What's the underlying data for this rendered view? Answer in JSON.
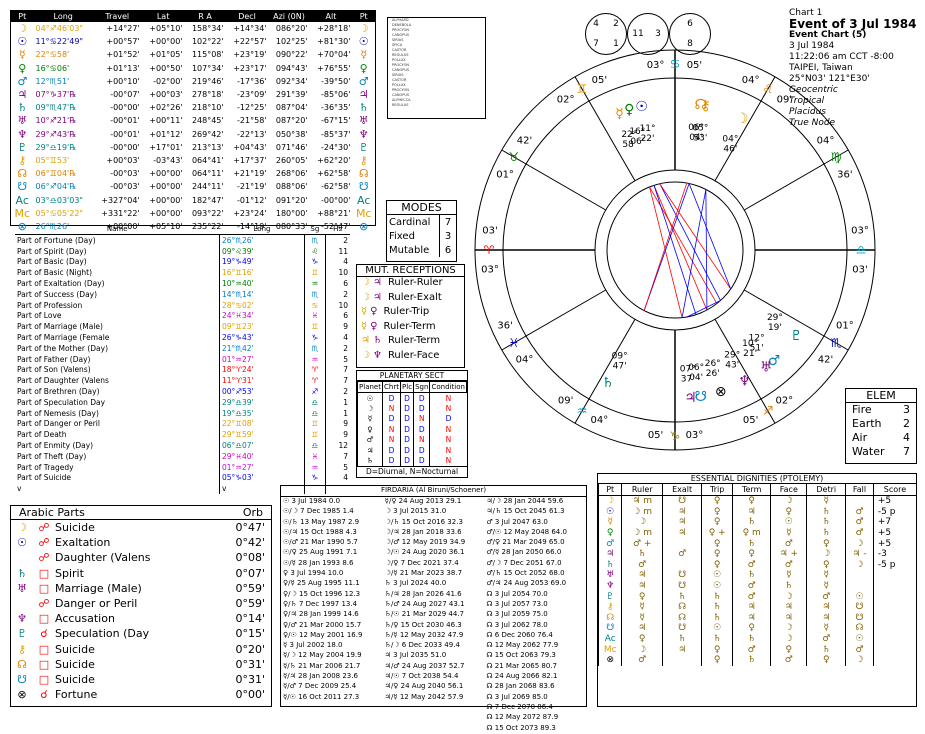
{
  "colors": {
    "blue": "#0000ff",
    "red": "#ff0000",
    "green": "#008000",
    "cyan": "#00a0c0",
    "orange": "#e08000",
    "purple": "#800080",
    "brown": "#804000",
    "olive": "#808000",
    "magenta": "#d000d0"
  },
  "positions": {
    "headers": [
      "Pt",
      "Long",
      "Travel",
      "Lat",
      "R A",
      "Decl",
      "Azi (0N)",
      "Alt",
      "Pt"
    ],
    "rows": [
      {
        "g": "☽",
        "long": "04°♐46'03\"",
        "travel": "+14°27'",
        "lat": "+05°10'",
        "ra": "158°34'",
        "decl": "+14°34'",
        "azi": "086°20'",
        "alt": "+28°18'",
        "c": "#e0a000"
      },
      {
        "g": "☉",
        "long": "11°♋22'49\"",
        "travel": "+00°57'",
        "lat": "+00°00'",
        "ra": "102°22'",
        "decl": "+22°57'",
        "azi": "102°25'",
        "alt": "+81°30'",
        "c": "#0000c0"
      },
      {
        "g": "☿",
        "long": "22°♋58'",
        "travel": "+01°52'",
        "lat": "+01°05'",
        "ra": "115°08'",
        "decl": "+23°19'",
        "azi": "090°22'",
        "alt": "+70°04'",
        "c": "#e08000"
      },
      {
        "g": "♀",
        "long": "16°♋06'",
        "travel": "+01°13'",
        "lat": "+00°50'",
        "ra": "107°34'",
        "decl": "+23°17'",
        "azi": "094°43'",
        "alt": "+76°55'",
        "c": "#008000"
      },
      {
        "g": "♂",
        "long": "12°♏51'",
        "travel": "+00°10'",
        "lat": "-02°00'",
        "ra": "219°46'",
        "decl": "-17°36'",
        "azi": "092°34'",
        "alt": "-39°50'",
        "c": "#0080c0"
      },
      {
        "g": "♃",
        "long": "07°♑37'℞",
        "travel": "-00°07'",
        "lat": "+00°03'",
        "ra": "278°18'",
        "decl": "-23°09'",
        "azi": "291°39'",
        "alt": "-85°06'",
        "c": "#800080"
      },
      {
        "g": "♄",
        "long": "09°♏47'℞",
        "travel": "-00°00'",
        "lat": "+02°26'",
        "ra": "218°10'",
        "decl": "-12°25'",
        "azi": "087°04'",
        "alt": "-36°35'",
        "c": "#008080"
      },
      {
        "g": "♅",
        "long": "10°♐21'℞",
        "travel": "-00°01'",
        "lat": "+00°11'",
        "ra": "248°45'",
        "decl": "-21°58'",
        "azi": "087°20'",
        "alt": "-67°15'",
        "c": "#800080"
      },
      {
        "g": "♆",
        "long": "29°♐43'℞",
        "travel": "-00°01'",
        "lat": "+01°12'",
        "ra": "269°42'",
        "decl": "-22°13'",
        "azi": "050°38'",
        "alt": "-85°37'",
        "c": "#800080"
      },
      {
        "g": "♇",
        "long": "29°♎19'℞",
        "travel": "-00°00'",
        "lat": "+17°01'",
        "ra": "213°13'",
        "decl": "+04°43'",
        "azi": "071°46'",
        "alt": "-24°30'",
        "c": "#008080"
      },
      {
        "g": "⚷",
        "long": "05°♊53'",
        "travel": "+00°03'",
        "lat": "-03°43'",
        "ra": "064°41'",
        "decl": "+17°37'",
        "azi": "260°05'",
        "alt": "+62°20'",
        "c": "#e0a000"
      },
      {
        "g": "☊",
        "long": "06°♊04'℞",
        "travel": "-00°03'",
        "lat": "+00°00'",
        "ra": "064°11'",
        "decl": "+21°19'",
        "azi": "268°06'",
        "alt": "+62°58'",
        "c": "#e08000"
      },
      {
        "g": "☋",
        "long": "06°♐04'℞",
        "travel": "-00°03'",
        "lat": "+00°00'",
        "ra": "244°11'",
        "decl": "-21°19'",
        "azi": "088°06'",
        "alt": "-62°58'",
        "c": "#0080c0"
      },
      {
        "g": "Ac",
        "long": "03°♎03'03\"",
        "travel": "+327°04'",
        "lat": "+00°00'",
        "ra": "182°47'",
        "decl": "-01°12'",
        "azi": "091°20'",
        "alt": "-00°00'",
        "c": "#008080"
      },
      {
        "g": "Mc",
        "long": "05°♋05'22\"",
        "travel": "+331°22'",
        "lat": "+00°00'",
        "ra": "093°22'",
        "decl": "+23°24'",
        "azi": "180°00'",
        "alt": "+88°21'",
        "c": "#e0a000"
      },
      {
        "g": "⊗",
        "long": "26°♏26'",
        "travel": "+00°00'",
        "lat": "+05°10'",
        "ra": "235°22'",
        "decl": "-14°19'",
        "azi": "080°33'",
        "alt": "-52°47'",
        "c": "#0080c0"
      }
    ]
  },
  "aspect_list": [
    "ALPHARD",
    "DENEBOLA",
    "PROCYON",
    "CANOPUS",
    "SIRIUS",
    "SPICA",
    "CASTOR",
    "REGULUS",
    "POLLUX",
    "PROCYON",
    "CANOPUS",
    "SIRIUS",
    "CASTOR",
    "POLLUX",
    "PROCYON",
    "CANOPUS",
    "ALPHECCA",
    "REGULUS"
  ],
  "modes": {
    "title": "MODES",
    "rows": [
      {
        "k": "Cardinal",
        "v": "7"
      },
      {
        "k": "Fixed",
        "v": "3"
      },
      {
        "k": "Mutable",
        "v": "6"
      }
    ]
  },
  "mut": {
    "title": "MUT. RECEPTIONS",
    "rows": [
      {
        "a": "☽",
        "b": "♃",
        "t": "Ruler-Ruler"
      },
      {
        "a": "☽",
        "b": "♃",
        "t": "Ruler-Exalt"
      },
      {
        "a": "☿",
        "b": "♀",
        "t": "Ruler-Trip"
      },
      {
        "a": "☿",
        "b": "♀",
        "t": "Ruler-Term"
      },
      {
        "a": "♃",
        "b": "♄",
        "t": "Ruler-Term"
      },
      {
        "a": "☽",
        "b": "♆",
        "t": "Ruler-Face"
      }
    ]
  },
  "sect": {
    "title": "PLANETARY SECT",
    "headers": [
      "Planet",
      "Chrt",
      "Plc",
      "Sgn",
      "Condition"
    ],
    "rows": [
      [
        "☉",
        "D",
        "D",
        "D",
        "N"
      ],
      [
        "☽",
        "N",
        "D",
        "D",
        "N"
      ],
      [
        "☿",
        "D",
        "D",
        "N",
        "D"
      ],
      [
        "♀",
        "N",
        "D",
        "D",
        "N"
      ],
      [
        "♂",
        "N",
        "D",
        "N",
        "N"
      ],
      [
        "♃",
        "D",
        "D",
        "D",
        "N"
      ],
      [
        "♄",
        "D",
        "D",
        "D",
        "N"
      ]
    ],
    "footer": "D=Diurnal, N=Nocturnal"
  },
  "parts": {
    "headers": [
      "Name",
      "Long",
      "Sg",
      "Hs"
    ],
    "rows": [
      [
        "Part of Fortune (Day)",
        "26°♏26'",
        "♏",
        "2"
      ],
      [
        "Part of Spirit (Day)",
        "09°♌39'",
        "♌",
        "11"
      ],
      [
        "Part of Basic (Day)",
        "19°♑49'",
        "♑",
        "4"
      ],
      [
        "Part of Basic (Night)",
        "16°♊16'",
        "♊",
        "10"
      ],
      [
        "Part of Exaltation (Day)",
        "10°♒40'",
        "♒",
        "6"
      ],
      [
        "Part of Success (Day)",
        "14°♏14'",
        "♏",
        "2"
      ],
      [
        "Part of Profession",
        "28°♋02'",
        "♋",
        "10"
      ],
      [
        "Part of Love",
        "24°♓34'",
        "♓",
        "6"
      ],
      [
        "Part of Marriage (Male)",
        "09°♊23'",
        "♊",
        "9"
      ],
      [
        "Part of Marriage (Female",
        "26°♑43'",
        "♑",
        "4"
      ],
      [
        "Part of the Mother (Day)",
        "21°♏42'",
        "♏",
        "2"
      ],
      [
        "Part of Father (Day)",
        "01°♒27'",
        "♒",
        "5"
      ],
      [
        "Part of Son (Valens)",
        "18°♈24'",
        "♈",
        "7"
      ],
      [
        "Part of Daughter (Valens",
        "11°♈31'",
        "♈",
        "7"
      ],
      [
        "Part of Brethren (Day)",
        "00°♐53'",
        "♐",
        "2"
      ],
      [
        "Part of Speculation Day",
        "29°♎39'",
        "♎",
        "1"
      ],
      [
        "Part of Nemesis (Day)",
        "19°♎35'",
        "♎",
        "1"
      ],
      [
        "Part of Danger or Peril",
        "22°♊08'",
        "♊",
        "9"
      ],
      [
        "Part of Death",
        "29°♊59'",
        "♊",
        "9"
      ],
      [
        "Part of Enmity (Day)",
        "06°♎07'",
        "♎",
        "12"
      ],
      [
        "Part of Theft (Day)",
        "29°♓40'",
        "♓",
        "7"
      ],
      [
        "Part of Tragedy",
        "01°♒27'",
        "♒",
        "5"
      ],
      [
        "Part of Suicide",
        "05°♑03'",
        "♑",
        "4"
      ],
      [
        "v",
        "v",
        "",
        ""
      ]
    ]
  },
  "arabic": {
    "hdr_l": "Arabic Parts",
    "hdr_r": "Orb",
    "rows": [
      {
        "g1": "☽",
        "g2": "☍",
        "n": "Suicide",
        "o": "0°47'"
      },
      {
        "g1": "☉",
        "g2": "☍",
        "n": "Exaltation",
        "o": "0°42'"
      },
      {
        "g1": "",
        "g2": "☍",
        "n": "Daughter (Valens",
        "o": "0°08'"
      },
      {
        "g1": "♄",
        "g2": "□",
        "n": "Spirit",
        "o": "0°07'"
      },
      {
        "g1": "♅",
        "g2": "□",
        "n": "Marriage (Male)",
        "o": "0°59'"
      },
      {
        "g1": "",
        "g2": "☍",
        "n": "Danger or Peril",
        "o": "0°59'"
      },
      {
        "g1": "♆",
        "g2": "□",
        "n": "Accusation",
        "o": "0°14'"
      },
      {
        "g1": "♇",
        "g2": "☌",
        "n": "Speculation (Day",
        "o": "0°15'"
      },
      {
        "g1": "⚷",
        "g2": "□",
        "n": "Suicide",
        "o": "0°20'"
      },
      {
        "g1": "☊",
        "g2": "□",
        "n": "Suicide",
        "o": "0°31'"
      },
      {
        "g1": "☋",
        "g2": "□",
        "n": "Suicide",
        "o": "0°31'"
      },
      {
        "g1": "⊗",
        "g2": "☌",
        "n": "Fortune",
        "o": "0°00'"
      }
    ]
  },
  "firdaria": {
    "title": "FIRDARIA (Al Biruni/Schoener)",
    "cols": [
      [
        "☉ 3 Jul 1984 0.0",
        "☉/☽ 7 Dec 1985 1.4",
        "☉/♄ 13 May 1987 2.9",
        "☉/♃ 15 Oct 1988 4.3",
        "☉/♂ 21 Mar 1990 5.7",
        "☉/♀ 25 Aug 1991 7.1",
        "☉/☿ 28 Jan 1993 8.6",
        "♀ 3 Jul 1994 10.0",
        "♀/☿ 25 Aug 1995 11.1",
        "♀/☽ 15 Oct 1996 12.3",
        "♀/♄ 7 Dec 1997 13.4",
        "♀/♃ 28 Jan 1999 14.6",
        "♀/♂ 21 Mar 2000 15.7",
        "♀/☉ 12 May 2001 16.9",
        "☿ 3 Jul 2002 18.0",
        "☿/☽ 12 May 2004 19.9",
        "☿/♄ 21 Mar 2006 21.7",
        "☿/♃ 28 Jan 2008 23.6",
        "☿/♂ 7 Dec 2009 25.4",
        "☿/☉ 16 Oct 2011 27.3"
      ],
      [
        "☿/♀ 24 Aug 2013 29.1",
        "☽ 3 Jul 2015 31.0",
        "☽/♄ 15 Oct 2016 32.3",
        "☽/♃ 28 Jan 2018 33.6",
        "☽/♂ 12 May 2019 34.9",
        "☽/☉ 24 Aug 2020 36.1",
        "☽/♀ 7 Dec 2021 37.4",
        "☽/☿ 21 Mar 2023 38.7",
        "♄ 3 Jul 2024 40.0",
        "♄/♃ 28 Jan 2026 41.6",
        "♄/♂ 24 Aug 2027 43.1",
        "♄/☉ 21 Mar 2029 44.7",
        "♄/♀ 15 Oct 2030 46.3",
        "♄/☿ 12 May 2032 47.9",
        "♄/☽ 6 Dec 2033 49.4",
        "♃ 3 Jul 2035 51.0",
        "♃/♂ 24 Aug 2037 52.7",
        "♃/☉ 7 Oct 2038 54.4",
        "♃/♀ 24 Aug 2040 56.1",
        "♃/☿ 12 May 2042 57.9"
      ],
      [
        "♃/☽ 28 Jan 2044 59.6",
        "♃/♄ 15 Oct 2045 61.3",
        "♂ 3 Jul 2047 63.0",
        "♂/☉ 12 May 2048 64.0",
        "♂/♀ 21 Mar 2049 65.0",
        "♂/☿ 28 Jan 2050 66.0",
        "♂/☽ 7 Dec 2051 67.0",
        "♂/♄ 15 Oct 2052 68.0",
        "♂/♃ 24 Aug 2053 69.0",
        "☊ 3 Jul 2054 70.0",
        "☊ 3 Jul 2057 73.0",
        "☊ 3 Jul 2059 75.0",
        "☊ 3 Jul 2062 78.0",
        "☊ 6 Dec 2060 76.4",
        "☊ 12 May 2062 77.9",
        "☊ 15 Oct 2063 79.3",
        "☊ 21 Mar 2065 80.7",
        "☊ 24 Aug 2066 82.1",
        "☊ 28 Jan 2068 83.6",
        "☊ 3 Jul 2069 85.0",
        "☊ 7 Dec 2070 86.4",
        "☊ 12 May 2072 87.9",
        "☊ 15 Oct 2073 89.3"
      ]
    ]
  },
  "digs": {
    "title": "ESSENTIAL DIGNITIES (PTOLEMY)",
    "headers": [
      "Pt",
      "Ruler",
      "Exalt",
      "Trip",
      "Term",
      "Face",
      "Detri",
      "Fall",
      "Score"
    ],
    "rows": [
      [
        "☽",
        "♃ m",
        "☋",
        "♀",
        "♀",
        "☽",
        "☿",
        "",
        "+5"
      ],
      [
        "☉",
        "☽ m",
        "♃",
        "♀",
        "♃",
        "♀",
        "♄",
        "♂",
        "-5 p"
      ],
      [
        "☿",
        "☽",
        "♃",
        "♀",
        "♄",
        "☉",
        "♄",
        "♂",
        "+7"
      ],
      [
        "♀",
        "☽ m",
        "♃",
        "♀ +",
        "♀ m",
        "☿",
        "♄",
        "♂",
        "+5"
      ],
      [
        "♂",
        "♂ +",
        "",
        "♀",
        "♄",
        "♂",
        "♀",
        "☽",
        "+5"
      ],
      [
        "♃",
        "♄",
        "♂",
        "♀",
        "♀",
        "♃ +",
        "☽",
        "♃ -",
        "-3"
      ],
      [
        "♄",
        "♂",
        "",
        "♀",
        "♂",
        "♂",
        "♀",
        "☽",
        "-5 p"
      ],
      [
        "♅",
        "♃",
        "☋",
        "☉",
        "♄",
        "☿",
        "☿",
        "",
        ""
      ],
      [
        "♆",
        "♃",
        "☋",
        "☉",
        "♂",
        "♄",
        "☿",
        "",
        ""
      ],
      [
        "♇",
        "♀",
        "♄",
        "♄",
        "♂",
        "☽",
        "♂",
        "☉",
        ""
      ],
      [
        "⚷",
        "☿",
        "☊",
        "♄",
        "♃",
        "♃",
        "♃",
        "☋",
        ""
      ],
      [
        "☊",
        "☿",
        "☊",
        "♄",
        "♃",
        "♃",
        "♃",
        "☋",
        ""
      ],
      [
        "☋",
        "♃",
        "☋",
        "☉",
        "♀",
        "☽",
        "☿",
        "☊",
        ""
      ],
      [
        "Ac",
        "♀",
        "♄",
        "♄",
        "♄",
        "☽",
        "♂",
        "☉",
        ""
      ],
      [
        "Mc",
        "☽",
        "♃",
        "♀",
        "♂",
        "♀",
        "♄",
        "♂",
        ""
      ],
      [
        "⊗",
        "♂",
        "",
        "♀",
        "♄",
        "♂",
        "♀",
        "☽",
        ""
      ]
    ]
  },
  "elem": {
    "title": "ELEM",
    "rows": [
      {
        "k": "Fire",
        "v": "3"
      },
      {
        "k": "Earth",
        "v": "2"
      },
      {
        "k": "Air",
        "v": "4"
      },
      {
        "k": "Water",
        "v": "7"
      }
    ]
  },
  "info": {
    "l1": "Chart 1",
    "l2": "Event of 3 Jul 1984",
    "l3": "Event Chart (5)",
    "l4": "3 Jul 1984",
    "l5": "11:22:06 am  CCT -8:00",
    "l6": "TAIPEI, Taiwan",
    "l7": "25°N03' 121°E30'",
    "l8": "Geocentric",
    "l9": "Tropical",
    "l10": "Placidus",
    "l11": "True Node"
  },
  "hboxes": [
    {
      "a": "4",
      "b": "2",
      "c": "7",
      "d": "1"
    },
    {
      "a": "11",
      "b": "3",
      "c": "",
      "d": ""
    },
    {
      "a": "6",
      "b": "",
      "c": "8",
      "d": ""
    }
  ],
  "wheel": {
    "cusps": [
      {
        "lab": "03°",
        "sg": "♋",
        "m": "05'"
      },
      {
        "lab": "04°",
        "sg": "♌",
        "m": "09'"
      },
      {
        "lab": "04°",
        "sg": "♍",
        "m": "36'"
      },
      {
        "lab": "03°",
        "sg": "♎",
        "m": "03'"
      },
      {
        "lab": "01°",
        "sg": "♏",
        "m": "42'"
      },
      {
        "lab": "02°",
        "sg": "♐",
        "m": "05'"
      },
      {
        "lab": "03°",
        "sg": "♑",
        "m": "05'"
      },
      {
        "lab": "04°",
        "sg": "♒",
        "m": "09'"
      },
      {
        "lab": "04°",
        "sg": "♓",
        "m": "36'"
      },
      {
        "lab": "03°",
        "sg": "♈",
        "m": "03'"
      },
      {
        "lab": "01°",
        "sg": "♉",
        "m": "42'"
      },
      {
        "lab": "02°",
        "sg": "♊",
        "m": "05'"
      }
    ],
    "planets": [
      {
        "g": "☉",
        "deg": "11°",
        "min": "22'",
        "c": "#0000c0"
      },
      {
        "g": "☿",
        "deg": "22°",
        "min": "58'",
        "c": "#e08000"
      },
      {
        "g": "♀",
        "deg": "16°",
        "min": "06'",
        "c": "#008000"
      },
      {
        "g": "☽",
        "deg": "04°",
        "min": "46'",
        "c": "#e0a000"
      },
      {
        "g": "♂",
        "deg": "12°",
        "min": "51'",
        "c": "#0080c0"
      },
      {
        "g": "♄",
        "deg": "09°",
        "min": "47'",
        "c": "#008080"
      },
      {
        "g": "♅",
        "deg": "10°",
        "min": "21'",
        "c": "#800080"
      },
      {
        "g": "♆",
        "deg": "29°",
        "min": "43'",
        "c": "#800080"
      },
      {
        "g": "♃",
        "deg": "07°",
        "min": "37'",
        "c": "#800080"
      },
      {
        "g": "♇",
        "deg": "29°",
        "min": "19'",
        "c": "#008080"
      },
      {
        "g": "⚷",
        "deg": "05°",
        "min": "53'",
        "c": "#e0a000"
      },
      {
        "g": "☊",
        "deg": "06°",
        "min": "04'",
        "c": "#e08000"
      },
      {
        "g": "☋",
        "deg": "06°",
        "min": "04'",
        "c": "#0080c0"
      },
      {
        "g": "⊗",
        "deg": "26°",
        "min": "26'",
        "c": "#000000"
      }
    ]
  }
}
